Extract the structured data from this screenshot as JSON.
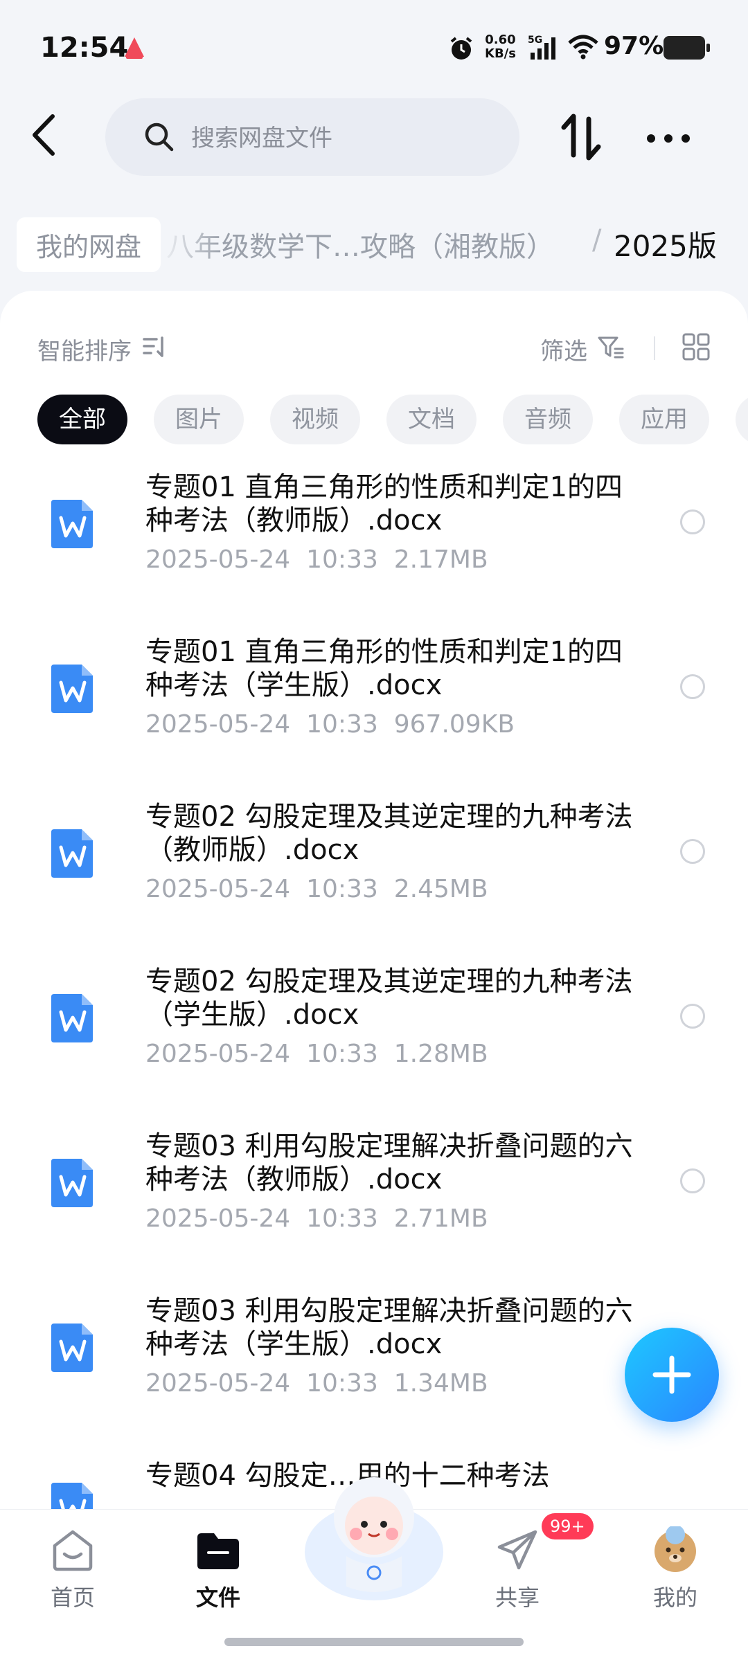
{
  "status_bar": {
    "time": "12:54",
    "net_speed_value": "0.60",
    "net_speed_unit": "KB/s",
    "network": "5G",
    "battery": "97%"
  },
  "search": {
    "placeholder": "搜索网盘文件"
  },
  "breadcrumb": {
    "home": "我的网盘",
    "middle": "八年级数学下…攻略（湘教版）",
    "separator": "/",
    "current": "2025版"
  },
  "toolbar": {
    "sort_label": "智能排序",
    "filter_label": "筛选"
  },
  "filter_chips": [
    "全部",
    "图片",
    "视频",
    "文档",
    "音频",
    "应用"
  ],
  "files": [
    {
      "name": "专题01 直角三角形的性质和判定1的四种考法（教师版）.docx",
      "date": "2025-05-24",
      "time": "10:33",
      "size": "2.17MB"
    },
    {
      "name": "专题01 直角三角形的性质和判定1的四种考法（学生版）.docx",
      "date": "2025-05-24",
      "time": "10:33",
      "size": "967.09KB"
    },
    {
      "name": "专题02 勾股定理及其逆定理的九种考法（教师版）.docx",
      "date": "2025-05-24",
      "time": "10:33",
      "size": "2.45MB"
    },
    {
      "name": "专题02 勾股定理及其逆定理的九种考法（学生版）.docx",
      "date": "2025-05-24",
      "time": "10:33",
      "size": "1.28MB"
    },
    {
      "name": "专题03 利用勾股定理解决折叠问题的六种考法（教师版）.docx",
      "date": "2025-05-24",
      "time": "10:33",
      "size": "2.71MB"
    },
    {
      "name": "专题03 利用勾股定理解决折叠问题的六种考法（学生版）.docx",
      "date": "2025-05-24",
      "time": "10:33",
      "size": "1.34MB"
    },
    {
      "name": "专题04 勾股定…用的十二种考法",
      "date": "",
      "time": "",
      "size": ""
    }
  ],
  "bottom_nav": [
    {
      "label": "首页",
      "icon": "home-icon"
    },
    {
      "label": "文件",
      "icon": "folder-icon"
    },
    {
      "label": "共享",
      "icon": "share-icon",
      "badge": "99+"
    },
    {
      "label": "我的",
      "icon": "avatar-icon"
    }
  ],
  "colors": {
    "accent": "#2a86ff",
    "fab_gradient_start": "#1ec8ff",
    "badge": "#ff3b57",
    "word_icon": "#3a8bf5"
  }
}
